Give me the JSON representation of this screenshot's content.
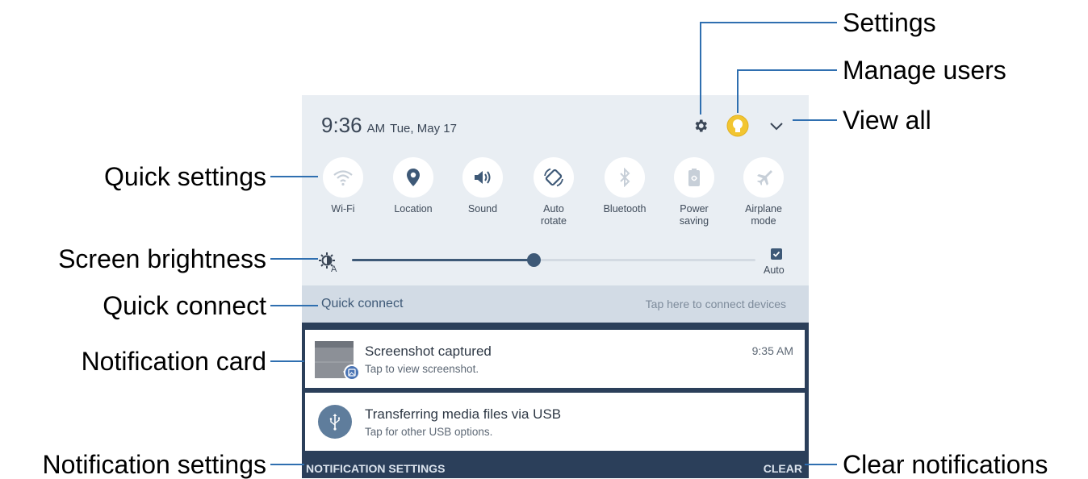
{
  "status": {
    "time": "9:36",
    "ampm": "AM",
    "date": "Tue, May 17"
  },
  "quick_settings": [
    {
      "label_line1": "Wi-Fi",
      "label_line2": "",
      "icon": "wifi-icon"
    },
    {
      "label_line1": "Location",
      "label_line2": "",
      "icon": "location-icon"
    },
    {
      "label_line1": "Sound",
      "label_line2": "",
      "icon": "sound-icon"
    },
    {
      "label_line1": "Auto",
      "label_line2": "rotate",
      "icon": "auto-rotate-icon"
    },
    {
      "label_line1": "Bluetooth",
      "label_line2": "",
      "icon": "bluetooth-icon"
    },
    {
      "label_line1": "Power",
      "label_line2": "saving",
      "icon": "power-saving-icon"
    },
    {
      "label_line1": "Airplane",
      "label_line2": "mode",
      "icon": "airplane-icon"
    }
  ],
  "brightness": {
    "level": 0.45,
    "auto_label": "Auto",
    "auto_checked": true
  },
  "quick_connect": {
    "title": "Quick connect",
    "hint": "Tap here to connect devices"
  },
  "notifications": [
    {
      "title": "Screenshot captured",
      "subtitle": "Tap to view screenshot.",
      "time": "9:35 AM"
    },
    {
      "title": "Transferring media files via USB",
      "subtitle": "Tap for other USB options."
    }
  ],
  "bottom_bar": {
    "settings_label": "NOTIFICATION SETTINGS",
    "clear_label": "CLEAR"
  },
  "callouts": {
    "settings": "Settings",
    "manage_users": "Manage users",
    "view_all": "View all",
    "quick_settings": "Quick settings",
    "screen_brightness": "Screen brightness",
    "quick_connect": "Quick connect",
    "notification_card": "Notification card",
    "notification_settings": "Notification settings",
    "clear_notifications": "Clear notifications"
  },
  "colors": {
    "accent": "#2f6fb0",
    "panel_bg": "#e9eef3",
    "dark_bar": "#2b3f5a",
    "icon_primary": "#3e5977",
    "avatar": "#f2c531"
  }
}
